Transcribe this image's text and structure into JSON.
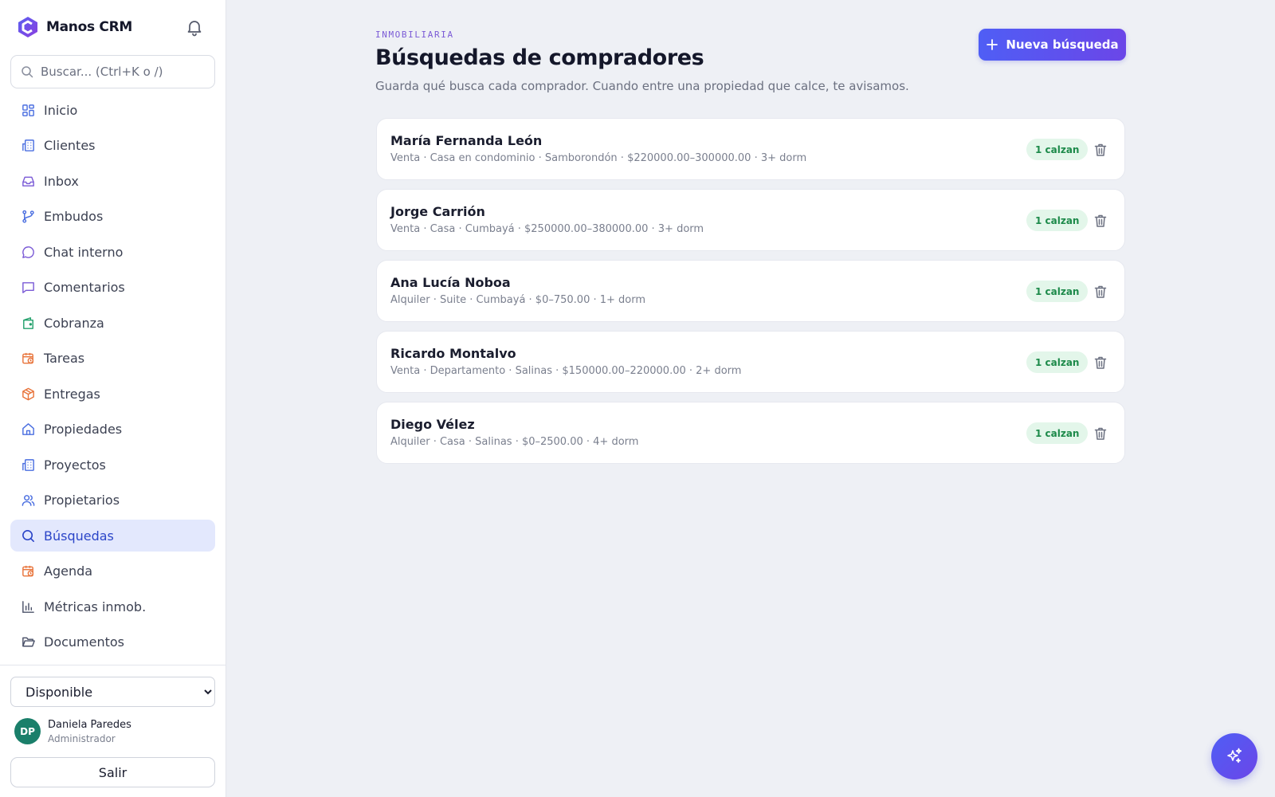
{
  "app": {
    "name": "Manos CRM"
  },
  "search": {
    "placeholder": "Buscar... (Ctrl+K o /)"
  },
  "sidebar": {
    "items": [
      {
        "label": "Inicio",
        "icon": "dashboard-icon",
        "active": false
      },
      {
        "label": "Clientes",
        "icon": "building-icon",
        "active": false
      },
      {
        "label": "Inbox",
        "icon": "inbox-icon",
        "active": false
      },
      {
        "label": "Embudos",
        "icon": "git-branch-icon",
        "active": false
      },
      {
        "label": "Chat interno",
        "icon": "chat-bubble-icon",
        "active": false
      },
      {
        "label": "Comentarios",
        "icon": "comment-icon",
        "active": false
      },
      {
        "label": "Cobranza",
        "icon": "wallet-icon",
        "active": false
      },
      {
        "label": "Tareas",
        "icon": "calendar-clock-icon",
        "active": false
      },
      {
        "label": "Entregas",
        "icon": "package-icon",
        "active": false
      },
      {
        "label": "Propiedades",
        "icon": "house-icon",
        "active": false
      },
      {
        "label": "Proyectos",
        "icon": "building-icon",
        "active": false
      },
      {
        "label": "Propietarios",
        "icon": "users-icon",
        "active": false
      },
      {
        "label": "Búsquedas",
        "icon": "search-icon",
        "active": true
      },
      {
        "label": "Agenda",
        "icon": "calendar-clock-icon",
        "active": false
      },
      {
        "label": "Métricas inmob.",
        "icon": "bar-chart-icon",
        "active": false
      },
      {
        "label": "Documentos",
        "icon": "folder-open-icon",
        "active": false
      }
    ]
  },
  "status": {
    "selected": "Disponible"
  },
  "user": {
    "initials": "DP",
    "name": "Daniela Paredes",
    "role": "Administrador"
  },
  "logout_label": "Salir",
  "main": {
    "eyebrow": "INMOBILIARIA",
    "title": "Búsquedas de compradores",
    "subtitle": "Guarda qué busca cada comprador. Cuando entre una propiedad que calce, te avisamos.",
    "new_button_label": "Nueva búsqueda",
    "searches": [
      {
        "name": "María Fernanda León",
        "meta": "Venta · Casa en condominio · Samborondón · $220000.00–300000.00 · 3+ dorm",
        "badge": "1 calzan"
      },
      {
        "name": "Jorge Carrión",
        "meta": "Venta · Casa · Cumbayá · $250000.00–380000.00 · 3+ dorm",
        "badge": "1 calzan"
      },
      {
        "name": "Ana Lucía Noboa",
        "meta": "Alquiler · Suite · Cumbayá · $0–750.00 · 1+ dorm",
        "badge": "1 calzan"
      },
      {
        "name": "Ricardo Montalvo",
        "meta": "Venta · Departamento · Salinas · $150000.00–220000.00 · 2+ dorm",
        "badge": "1 calzan"
      },
      {
        "name": "Diego Vélez",
        "meta": "Alquiler · Casa · Salinas · $0–2500.00 · 4+ dorm",
        "badge": "1 calzan"
      }
    ]
  },
  "colors": {
    "accent": "#4f5ef5",
    "accent_purple": "#6b46e8",
    "active_nav_bg": "#e3e8fd",
    "badge_bg": "#e3f6ea",
    "badge_text": "#1d8a4a",
    "avatar_bg": "#1a7f6a"
  }
}
